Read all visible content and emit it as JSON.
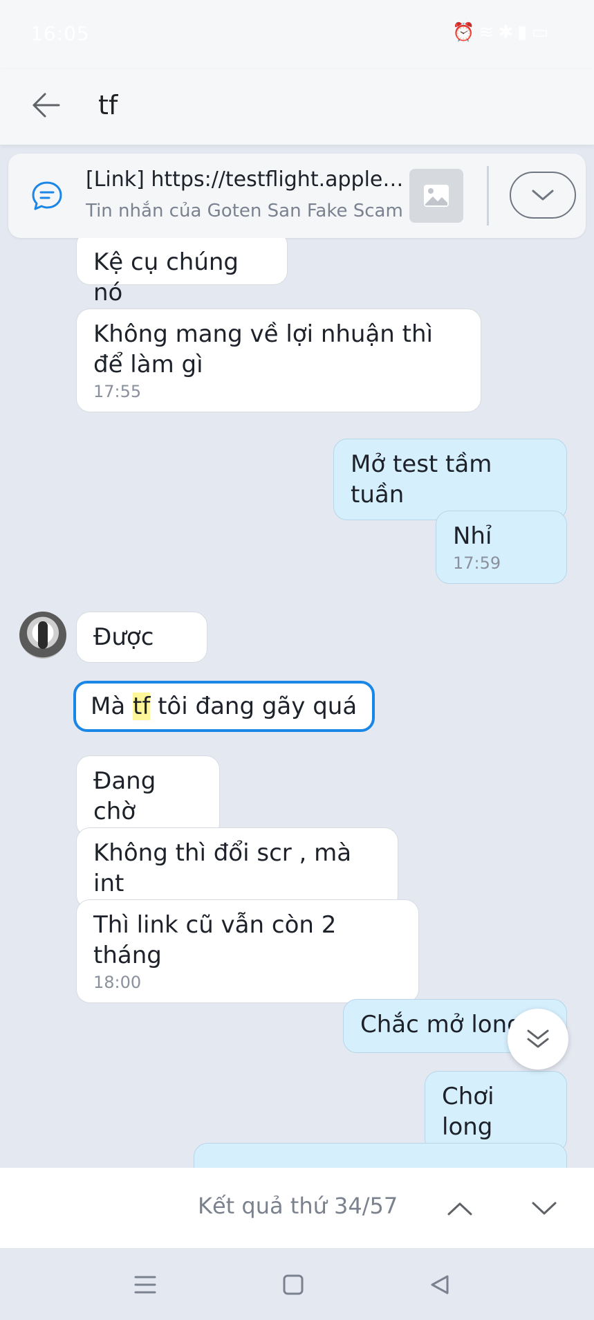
{
  "status_bar": {
    "time": "16:05",
    "icons": [
      "alarm-icon",
      "wifi-icon",
      "bluetooth-icon",
      "signal-icon",
      "battery-icon"
    ]
  },
  "header": {
    "search_query": "tf",
    "back_icon": "arrow-left-icon"
  },
  "pinned": {
    "title": "[Link] https://testflight.apple.com/join/...",
    "subtitle": "Tin nhắn của Goten San Fake Scam",
    "icon": "chat-bubble-icon",
    "thumbnail_icon": "image-icon",
    "expand_icon": "chevron-down-icon"
  },
  "messages": [
    {
      "text": "Kệ cụ chúng nó",
      "direction": "in"
    },
    {
      "text": "Không mang về lợi nhuận thì để làm gì",
      "direction": "in",
      "time": "17:55"
    },
    {
      "text": "Mở test tầm tuần",
      "direction": "out"
    },
    {
      "text": "Nhỉ",
      "direction": "out",
      "time": "17:59"
    },
    {
      "text": "Được",
      "direction": "in"
    },
    {
      "text_before": "Mà ",
      "highlight": "tf",
      "text_after": " tôi đang gãy quá",
      "direction": "in",
      "search_match": true
    },
    {
      "text": "Đang chờ",
      "direction": "in"
    },
    {
      "text": "Không thì đổi scr , mà int",
      "direction": "in"
    },
    {
      "text": "Thì link cũ vẫn còn 2 tháng",
      "direction": "in",
      "time": "18:00"
    },
    {
      "text": "Chắc mở long",
      "direction": "out"
    },
    {
      "text": "Chơi long",
      "direction": "out"
    }
  ],
  "search_result": {
    "label": "Kết quả thứ 34/57"
  },
  "colors": {
    "chat_background": "#e4e8f1",
    "incoming_bubble": "#ffffff",
    "outgoing_bubble": "#d6effd",
    "highlight_border": "#1a86e6",
    "match_highlight": "#fdf69a"
  }
}
